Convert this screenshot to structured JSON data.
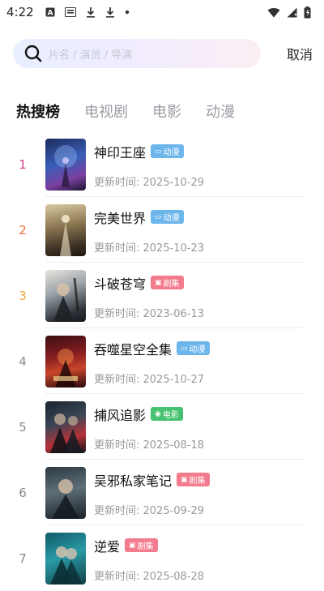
{
  "status_bar": {
    "time": "4:22",
    "icons": [
      "a-icon",
      "text-icon",
      "download-icon",
      "download-icon",
      "dot-icon"
    ],
    "right_icons": [
      "wifi-icon",
      "signal-icon",
      "battery-icon"
    ]
  },
  "search": {
    "placeholder": "片名 / 演员 / 导演",
    "cancel_label": "取消"
  },
  "tabs": [
    {
      "label": "热搜榜",
      "active": true
    },
    {
      "label": "电视剧",
      "active": false
    },
    {
      "label": "电影",
      "active": false
    },
    {
      "label": "动漫",
      "active": false
    }
  ],
  "update_prefix": "更新时间:",
  "items": [
    {
      "rank": "1",
      "title": "神印王座",
      "tag": "动漫",
      "updated": "更新时间:  2025-10-29"
    },
    {
      "rank": "2",
      "title": "完美世界",
      "tag": "动漫",
      "updated": "更新时间:  2025-10-23"
    },
    {
      "rank": "3",
      "title": "斗破苍穹",
      "tag": "剧集",
      "updated": "更新时间:  2023-06-13"
    },
    {
      "rank": "4",
      "title": "吞噬星空全集",
      "tag": "动漫",
      "updated": "更新时间:  2025-10-27"
    },
    {
      "rank": "5",
      "title": "捕风追影",
      "tag": "电影",
      "updated": "更新时间:  2025-08-18"
    },
    {
      "rank": "6",
      "title": "吴邪私家笔记",
      "tag": "剧集",
      "updated": "更新时间:  2025-09-29"
    },
    {
      "rank": "7",
      "title": "逆爱",
      "tag": "剧集",
      "updated": "更新时间:  2025-08-28"
    }
  ],
  "colors": {
    "rank_1": "#d63c8a",
    "rank_2": "#e8733f",
    "rank_3": "#f0a93a",
    "rank_other": "#8a8a8a",
    "tag_anime": "#6db6ec",
    "tag_series": "#f27b8d",
    "tag_movie": "#45c26f"
  }
}
